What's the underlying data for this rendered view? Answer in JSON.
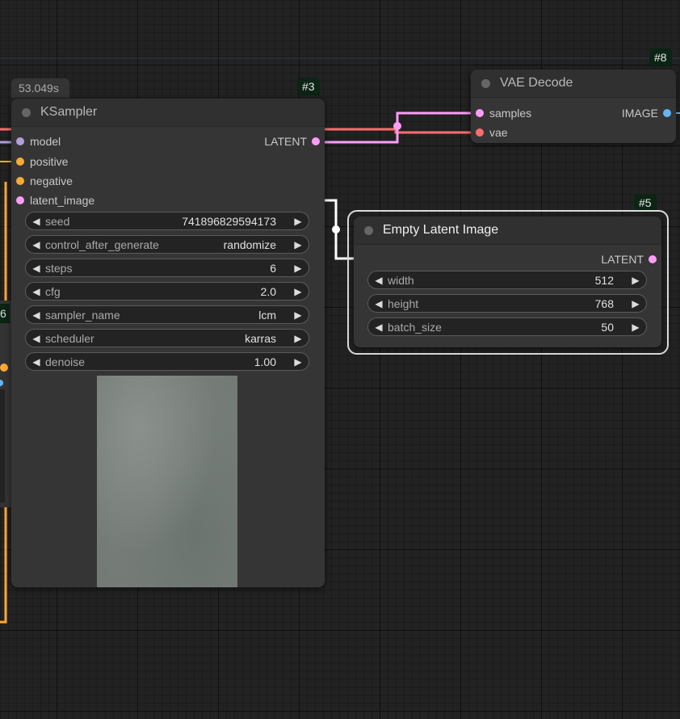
{
  "colors": {
    "model": "#b39ddb",
    "conditioning": "#ffa931",
    "latent": "#ff9cf9",
    "vae": "#ff6e6e",
    "image": "#64b5f6",
    "canvas_bg": "#222222",
    "node_bg": "#353535",
    "badge_bg": "#0b2414"
  },
  "offscreen_left": {
    "fragment_label": "6"
  },
  "ksampler": {
    "badge": "#3",
    "exec_time": "53.049s",
    "title": "KSampler",
    "inputs": [
      {
        "label": "model",
        "type": "model"
      },
      {
        "label": "positive",
        "type": "conditioning"
      },
      {
        "label": "negative",
        "type": "conditioning"
      },
      {
        "label": "latent_image",
        "type": "latent"
      }
    ],
    "output": {
      "label": "LATENT",
      "type": "latent"
    },
    "widgets": [
      {
        "label": "seed",
        "value": "741896829594173"
      },
      {
        "label": "control_after_generate",
        "value": "randomize"
      },
      {
        "label": "steps",
        "value": "6"
      },
      {
        "label": "cfg",
        "value": "2.0"
      },
      {
        "label": "sampler_name",
        "value": "lcm"
      },
      {
        "label": "scheduler",
        "value": "karras"
      },
      {
        "label": "denoise",
        "value": "1.00"
      }
    ]
  },
  "vae_decode": {
    "badge": "#8",
    "title": "VAE Decode",
    "inputs": [
      {
        "label": "samples",
        "type": "latent"
      },
      {
        "label": "vae",
        "type": "vae"
      }
    ],
    "output": {
      "label": "IMAGE",
      "type": "image"
    }
  },
  "empty_latent": {
    "badge": "#5",
    "title": "Empty Latent Image",
    "output": {
      "label": "LATENT",
      "type": "latent"
    },
    "widgets": [
      {
        "label": "width",
        "value": "512"
      },
      {
        "label": "height",
        "value": "768"
      },
      {
        "label": "batch_size",
        "value": "50"
      }
    ]
  }
}
